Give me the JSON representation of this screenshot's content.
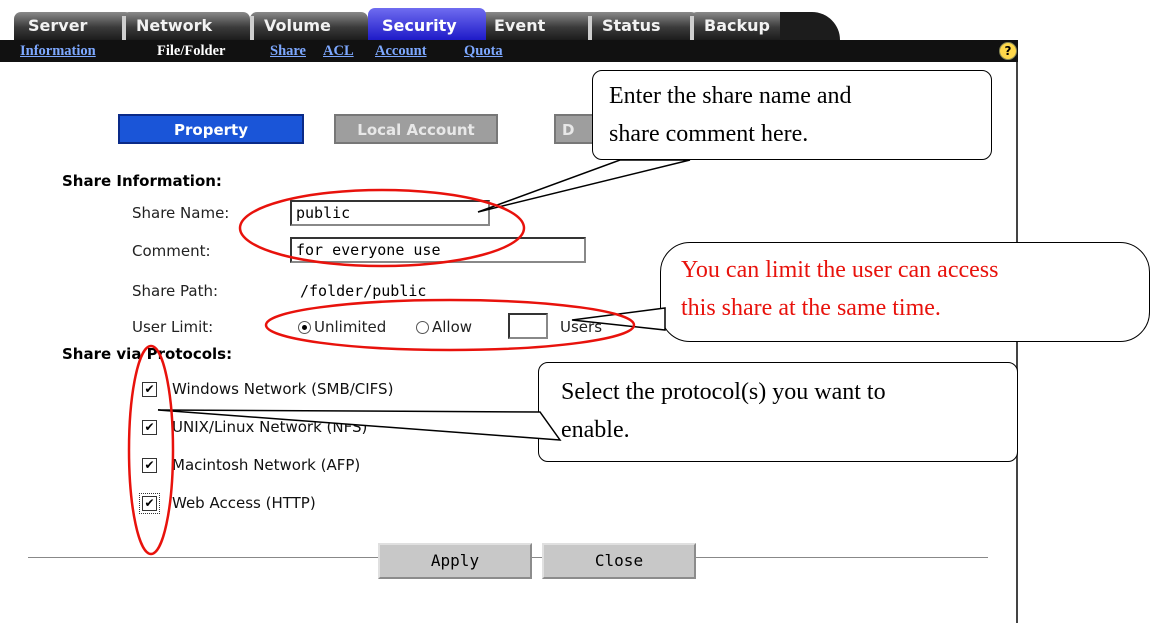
{
  "tabs": [
    {
      "label": "Server",
      "active": false
    },
    {
      "label": "Network",
      "active": false
    },
    {
      "label": "Volume",
      "active": false
    },
    {
      "label": "Security",
      "active": true
    },
    {
      "label": "Event",
      "active": false
    },
    {
      "label": "Status",
      "active": false
    },
    {
      "label": "Backup",
      "active": false
    }
  ],
  "subnav": {
    "items": [
      "Information",
      "File/Folder",
      "Share",
      "ACL",
      "Account",
      "Quota"
    ],
    "current": "File/Folder",
    "help_icon": "?"
  },
  "panel_tabs": {
    "property": "Property",
    "local_account": "Local Account",
    "d": "D"
  },
  "share_info": {
    "heading": "Share Information:",
    "name_label": "Share Name:",
    "name_value": "public",
    "comment_label": "Comment:",
    "comment_value": "for everyone use",
    "path_label": "Share Path:",
    "path_value": "/folder/public",
    "limit_label": "User Limit:",
    "unlimited_label": "Unlimited",
    "allow_label": "Allow",
    "users_label": "Users",
    "limit_choice": "Unlimited",
    "allow_value": ""
  },
  "protocols": {
    "heading": "Share via Protocols:",
    "items": [
      {
        "label": "Windows Network (SMB/CIFS)",
        "checked": true
      },
      {
        "label": "UNIX/Linux Network (NFS)",
        "checked": true
      },
      {
        "label": "Macintosh Network (AFP)",
        "checked": true
      },
      {
        "label": "Web Access (HTTP)",
        "checked": true
      }
    ]
  },
  "buttons": {
    "apply": "Apply",
    "close": "Close"
  },
  "callouts": {
    "share": {
      "line1": "Enter the share name and",
      "line2": "share comment here."
    },
    "limit": {
      "line1": "You can limit the user can access",
      "line2": "this share at the same time.",
      "color": "#e8120c"
    },
    "protocol": {
      "line1": "Select the protocol(s) you want to",
      "line2": "enable."
    }
  },
  "colors": {
    "annotation_red": "#e8120c",
    "active_tab": "#1e1ac8",
    "link": "#7da8ff"
  }
}
